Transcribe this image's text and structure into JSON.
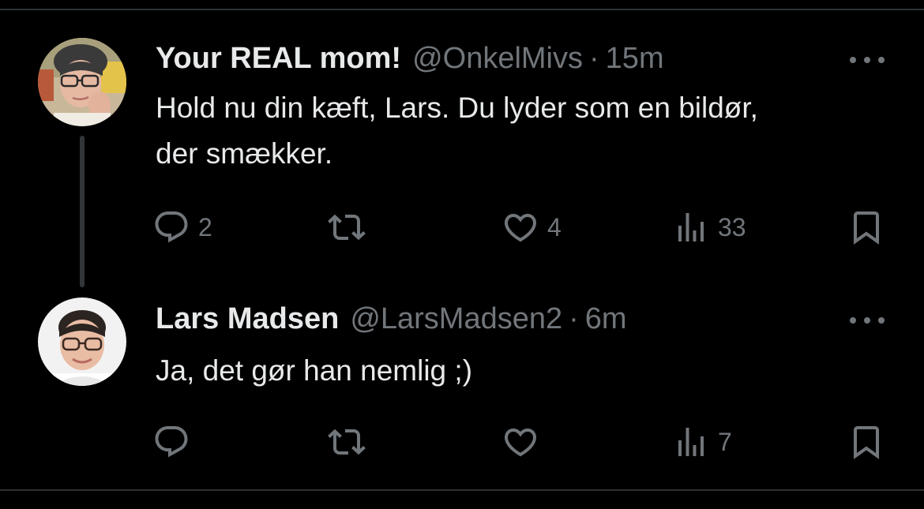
{
  "tweets": [
    {
      "display_name": "Your REAL mom!",
      "handle": "@OnkelMivs",
      "separator": "·",
      "time": "15m",
      "text": "Hold nu din kæft, Lars. Du lyder som en bildør,\nder smækker.",
      "avatar": "avatar-woman-glasses",
      "counts": {
        "replies": "2",
        "retweets": "",
        "likes": "4",
        "views": "33"
      }
    },
    {
      "display_name": "Lars Madsen",
      "handle": "@LarsMadsen2",
      "separator": "·",
      "time": "6m",
      "text": "Ja, det gør han nemlig ;)",
      "avatar": "avatar-man-glasses",
      "counts": {
        "replies": "",
        "retweets": "",
        "likes": "",
        "views": "7"
      }
    }
  ],
  "icons": {
    "reply": "reply-icon",
    "retweet": "retweet-icon",
    "like": "heart-icon",
    "views": "views-icon",
    "bookmark": "bookmark-icon",
    "more": "more-icon"
  },
  "colors": {
    "background": "#000000",
    "text_primary": "#e7e9ea",
    "text_secondary": "#71767b",
    "divider": "#2f3336",
    "thread_line": "#333639"
  }
}
